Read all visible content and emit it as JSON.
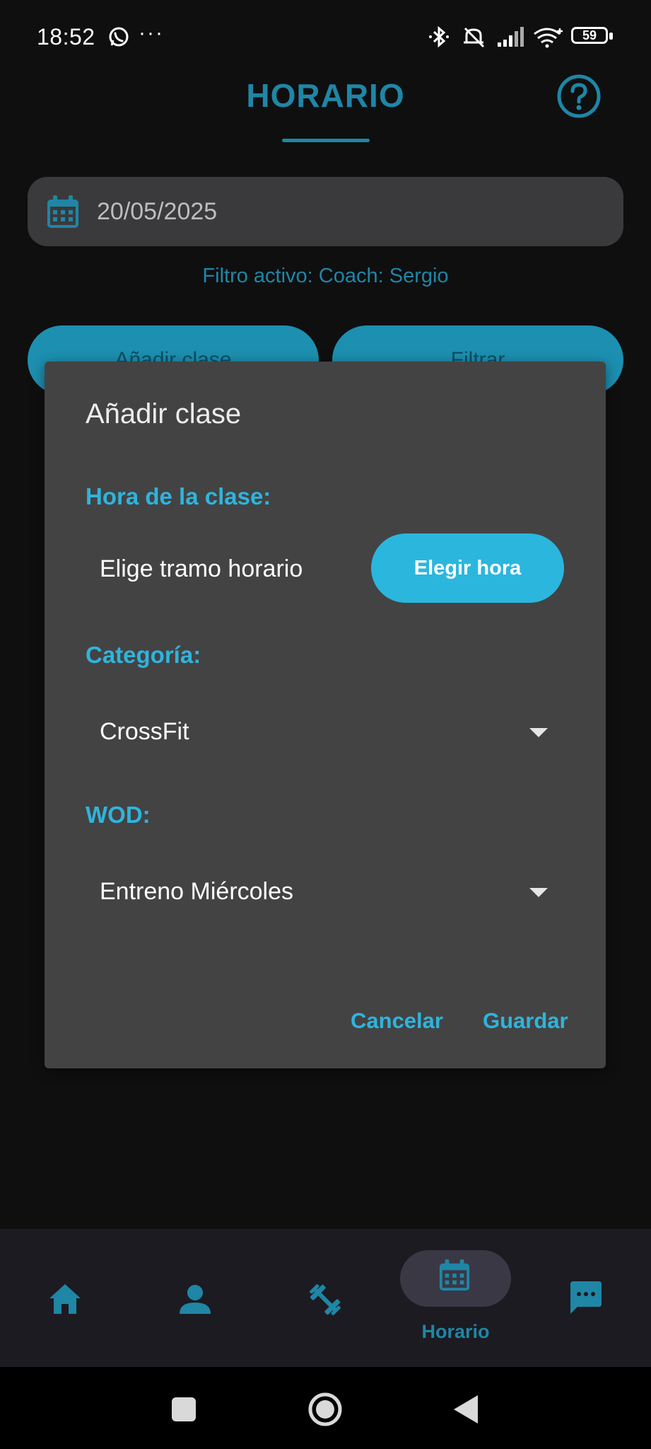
{
  "status_bar": {
    "time": "18:52",
    "overflow": "···",
    "battery": "59",
    "icons": [
      "whatsapp-icon",
      "bluetooth-icon",
      "mute-icon",
      "signal-icon",
      "wifi-icon",
      "battery-icon"
    ]
  },
  "header": {
    "title": "HORARIO",
    "help_icon": "help-circle-icon"
  },
  "date_field": {
    "value": "20/05/2025",
    "icon": "calendar-icon"
  },
  "filter_text": "Filtro activo: Coach: Sergio",
  "background_buttons": {
    "add": "Añadir clase",
    "filter": "Filtrar"
  },
  "dialog": {
    "title": "Añadir clase",
    "time_section": {
      "label": "Hora de la clase:",
      "placeholder": "Elige tramo horario",
      "button": "Elegir hora"
    },
    "category_section": {
      "label": "Categoría:",
      "selected": "CrossFit"
    },
    "wod_section": {
      "label": "WOD:",
      "selected": "Entreno Miércoles"
    },
    "actions": {
      "cancel": "Cancelar",
      "save": "Guardar"
    }
  },
  "bottom_nav": {
    "active_label": "Horario",
    "items": [
      "home-icon",
      "person-icon",
      "dumbbell-icon",
      "calendar-icon",
      "chat-icon"
    ]
  },
  "colors": {
    "accent": "#2bb6de",
    "accent_dark": "#1f86a6",
    "background": "#0f0f10",
    "dialog": "#434344"
  }
}
